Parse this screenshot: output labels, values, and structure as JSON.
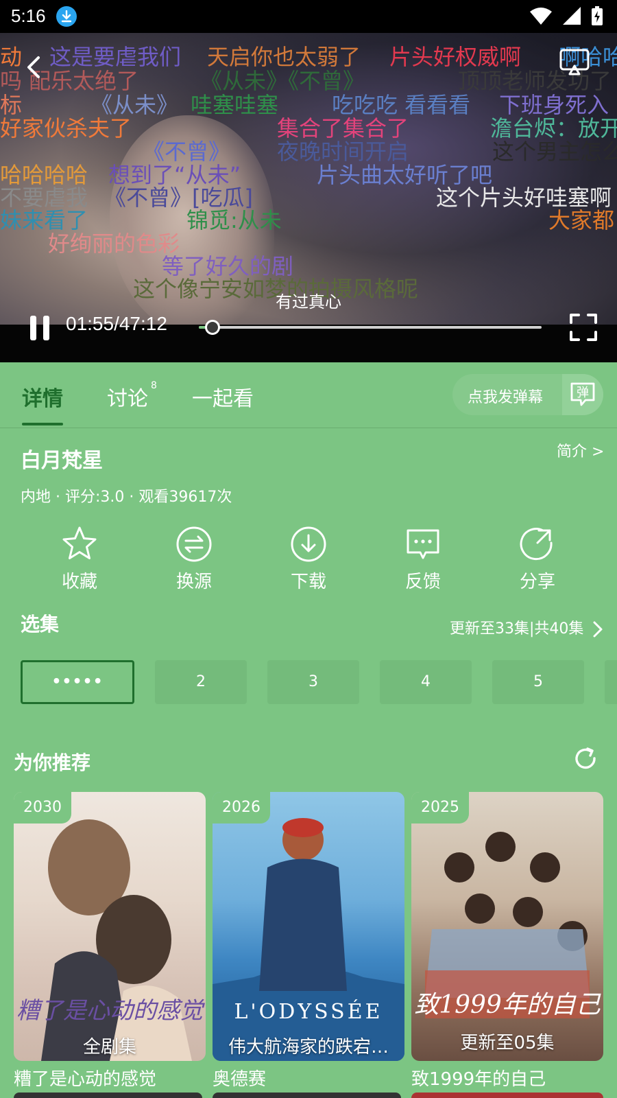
{
  "status_bar": {
    "time": "5:16"
  },
  "player": {
    "danmaku": [
      {
        "text": "动",
        "color": "#f07a3a"
      },
      {
        "text": "这是要虐我们",
        "color": "#6f5cc6"
      },
      {
        "text": "天启你也太弱了",
        "color": "#d2793a"
      },
      {
        "text": "片头好权威啊",
        "color": "#e3394f"
      },
      {
        "text": "啊哈哈",
        "color": "#3b8fd6"
      },
      {
        "text": "吗 配乐太绝了",
        "color": "#b35a5a"
      },
      {
        "text": "《从未》《不曾》",
        "color": "#2f6a3a"
      },
      {
        "text": "顶顶老师发功了",
        "color": "#3a3a3a"
      },
      {
        "text": "标",
        "color": "#e0785a"
      },
      {
        "text": "《从未》",
        "color": "#7b8fc9"
      },
      {
        "text": "哇塞哇塞",
        "color": "#2f8f4a"
      },
      {
        "text": "吃吃吃 看看看",
        "color": "#5a7fc2"
      },
      {
        "text": "下班身死入",
        "color": "#7f6fd0"
      },
      {
        "text": "好家伙杀夫了",
        "color": "#f07a3a"
      },
      {
        "text": "集合了集合了",
        "color": "#e3437b"
      },
      {
        "text": "澹台烬：放开",
        "color": "#4fb89a"
      },
      {
        "text": "《不曾》",
        "color": "#5b6ad0"
      },
      {
        "text": "夜晚时间开启",
        "color": "#4a5a9a"
      },
      {
        "text": "这个男主怎么",
        "color": "#2a2a2a"
      },
      {
        "text": "哈哈哈哈",
        "color": "#e39a3a"
      },
      {
        "text": "想到了“从未”",
        "color": "#6a4fb8"
      },
      {
        "text": "片头曲太好听了吧",
        "color": "#6a7fd0"
      },
      {
        "text": "不要虐我",
        "color": "#8a8a8a"
      },
      {
        "text": "《不曾》[吃瓜]",
        "color": "#4a4a9a"
      },
      {
        "text": "这个片头好哇塞啊",
        "color": "#e8e8e8"
      },
      {
        "text": "妹来看了",
        "color": "#2f8fb0"
      },
      {
        "text": "锦觅:从未",
        "color": "#2f8f4a"
      },
      {
        "text": "大家都",
        "color": "#e07a2a"
      },
      {
        "text": "好绚丽的色彩",
        "color": "#e08a8a"
      },
      {
        "text": "等了好久的剧",
        "color": "#7f5fc0"
      },
      {
        "text": "这个像宁安如梦的拍摄风格呢",
        "color": "#5a6a3a"
      }
    ],
    "subtitle": "有过真心",
    "timecode": "01:55/47:12",
    "progress_fraction": 0.04
  },
  "tabs": {
    "details": "详情",
    "discuss": "讨论",
    "discuss_count": "8",
    "watch_together": "一起看",
    "send_danmaku": "点我发弹幕",
    "danmaku_icon_text": "弹"
  },
  "info": {
    "title": "白月梵星",
    "intro_link": "简介 >",
    "meta": "内地 · 评分:3.0 · 观看39617次"
  },
  "actions": [
    {
      "label": "收藏",
      "icon": "star-icon"
    },
    {
      "label": "换源",
      "icon": "swap-icon"
    },
    {
      "label": "下载",
      "icon": "download-icon"
    },
    {
      "label": "反馈",
      "icon": "feedback-icon"
    },
    {
      "label": "分享",
      "icon": "share-icon"
    }
  ],
  "episodes": {
    "title": "选集",
    "link": "更新至33集|共40集",
    "items": [
      "•••••",
      "2",
      "3",
      "4",
      "5"
    ]
  },
  "recommend": {
    "title": "为你推荐",
    "cards": [
      {
        "year": "2030",
        "caption": "全剧集",
        "name": "糟了是心动的感觉",
        "poster_text": "糟了是心动的感觉"
      },
      {
        "year": "2026",
        "caption": "伟大航海家的跌宕…",
        "name": "奥德赛",
        "poster_text": "L'ODYSSÉE"
      },
      {
        "year": "2025",
        "caption": "更新至05集",
        "name": "致1999年的自己",
        "poster_text": "致1999年的自己"
      }
    ]
  },
  "colors": {
    "accent": "#7cc583",
    "accent_dark": "#1f6f2d",
    "progress": "#7cc583"
  }
}
